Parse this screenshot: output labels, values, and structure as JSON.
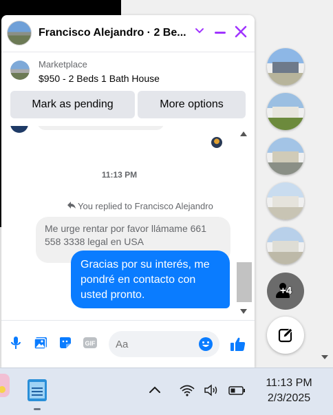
{
  "chat": {
    "title": "Francisco Alejandro · 2 Be...",
    "marketplace_label": "Marketplace",
    "listing": "$950 - 2 Beds 1 Bath House",
    "mark_pending": "Mark as pending",
    "more_options": "More options",
    "timestamp": "11:13 PM",
    "replied_to": "You replied to Francisco Alejandro",
    "incoming_message": "Me urge  rentar por favor llámame 661 558 3338  legal en USA",
    "outgoing_message": "Gracias por su interés, me pondré en contacto con usted pronto.",
    "composer_placeholder": "Aa"
  },
  "rail": {
    "more_badge": "+4"
  },
  "taskbar": {
    "time": "11:13 PM",
    "date": "2/3/2025"
  },
  "colors": {
    "accent": "#a033ff",
    "messenger_blue": "#0a7cff"
  }
}
